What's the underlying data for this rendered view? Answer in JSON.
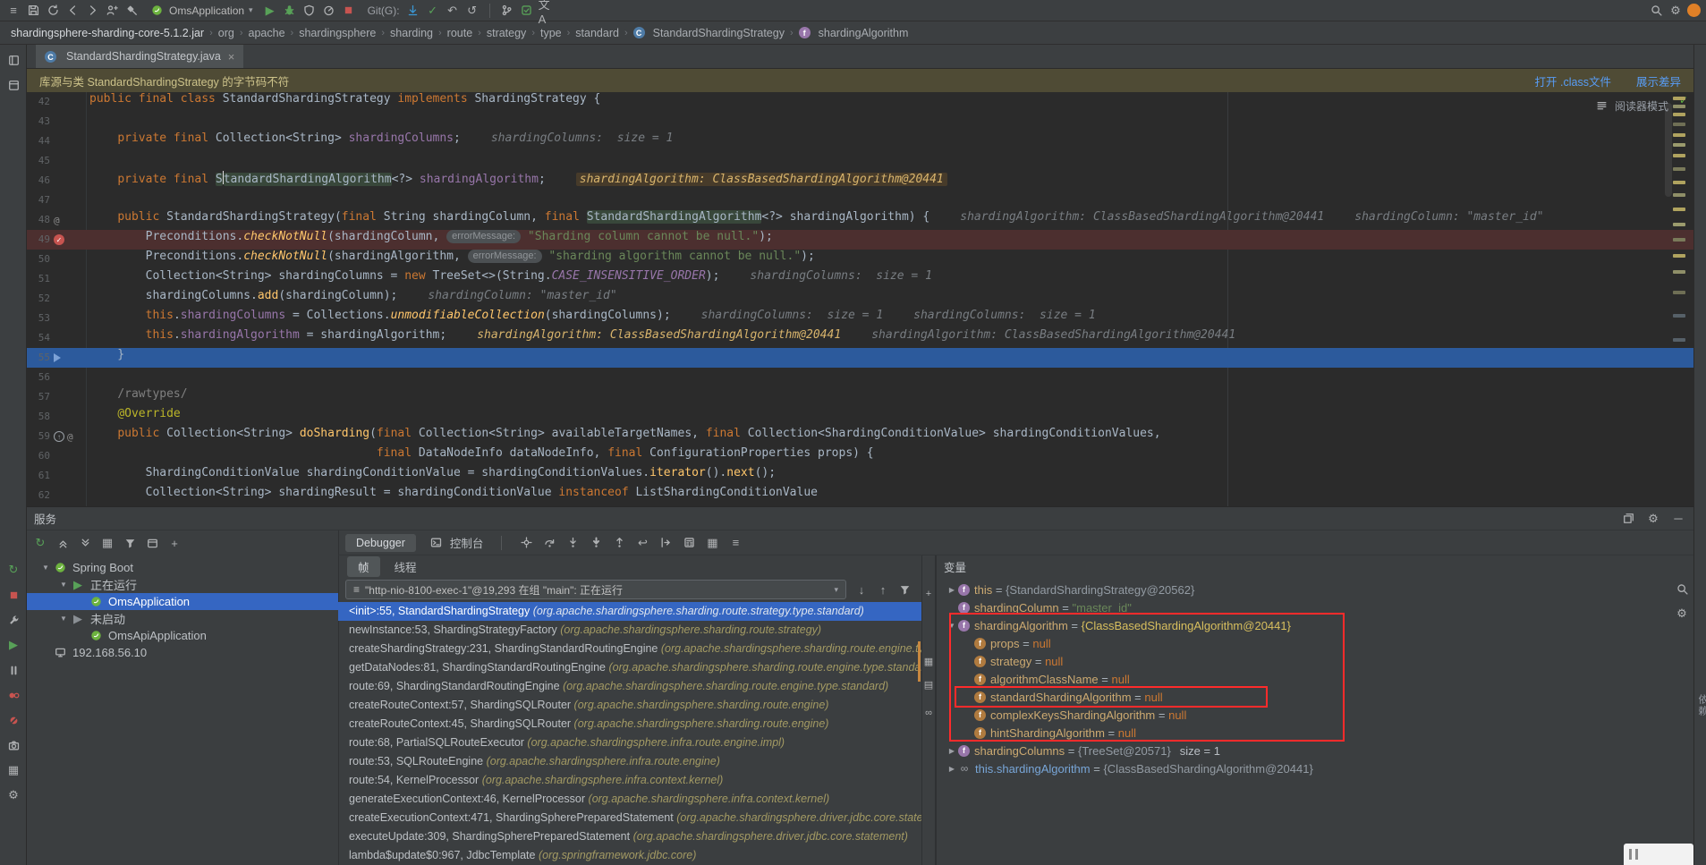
{
  "ide": {
    "left_stripe_top": [
      "project-stripe",
      "commit-stripe"
    ]
  },
  "colors": {
    "selection": "#3566c2",
    "execution_line": "#2c5a9c",
    "breakpoint_line": "#4c2f2f",
    "annotation_box": "#ff2b2b",
    "notification_bg": "#4f4b35",
    "link": "#589df6",
    "run_green": "#58a158",
    "stop_red": "#c75450",
    "spring_green": "#6db33f"
  },
  "toolbar": {
    "left_icons": [
      "main-menu",
      "save",
      "sync",
      "back",
      "forward",
      "project-structure",
      "build-hammer"
    ],
    "run_config": {
      "label": "OmsApplication"
    },
    "run_icons": [
      "run",
      "debug",
      "coverage",
      "profiler",
      "stop"
    ],
    "git": {
      "label": "Git(G):",
      "icons": [
        "update-project",
        "commit-check",
        "rollback",
        "show-history"
      ]
    },
    "vcs_icons": [
      "branch",
      "commit-push",
      "translate"
    ],
    "right_icons": [
      "search",
      "settings"
    ]
  },
  "breadcrumbs": {
    "items": [
      {
        "label": "shardingsphere-sharding-core-5.1.2.jar",
        "bold": true
      },
      {
        "label": "org"
      },
      {
        "label": "apache"
      },
      {
        "label": "shardingsphere"
      },
      {
        "label": "sharding"
      },
      {
        "label": "route"
      },
      {
        "label": "strategy"
      },
      {
        "label": "type"
      },
      {
        "label": "standard"
      },
      {
        "label": "StandardShardingStrategy",
        "icon": "class"
      },
      {
        "label": "shardingAlgorithm",
        "icon": "field"
      }
    ]
  },
  "tabs": [
    {
      "label": "StandardShardingStrategy.java",
      "icon": "class",
      "close": "×"
    }
  ],
  "notification": {
    "message": "库源与类 StandardShardingStrategy 的字节码不符",
    "actions": [
      "打开 .class文件",
      "展示差异"
    ]
  },
  "editor": {
    "reader_mode": "阅读器模式",
    "lines": [
      {
        "n": 42,
        "seg": [
          [
            "public final class ",
            "k"
          ],
          [
            "StandardShardingStrategy ",
            "t"
          ],
          [
            "implements ",
            "k"
          ],
          [
            "ShardingStrategy {",
            "t"
          ]
        ]
      },
      {
        "n": 43,
        "seg": []
      },
      {
        "n": 44,
        "seg": [
          [
            "    ",
            "t"
          ],
          [
            "private final ",
            "k"
          ],
          [
            "Collection<String> ",
            "t"
          ],
          [
            "shardingColumns",
            "f"
          ],
          [
            ";",
            "t"
          ]
        ],
        "hints": [
          [
            "shardingColumns:  size = 1",
            "g"
          ]
        ]
      },
      {
        "n": 45,
        "seg": []
      },
      {
        "n": 46,
        "seg": [
          [
            "    ",
            "t"
          ],
          [
            "private final ",
            "k"
          ],
          [
            "S",
            "hl"
          ],
          [
            "",
            "caret"
          ],
          [
            "tandardShardingAlgorithm",
            "hl"
          ],
          [
            "<?> ",
            "t"
          ],
          [
            "shardingAlgorithm",
            "f"
          ],
          [
            ";",
            "t"
          ]
        ],
        "hints": [
          [
            "shardingAlgorithm: ClassBasedShardingAlgorithm@20441",
            "goldbg"
          ]
        ]
      },
      {
        "n": 47,
        "seg": []
      },
      {
        "n": 48,
        "gutter": "at",
        "seg": [
          [
            "    ",
            "t"
          ],
          [
            "public ",
            "k"
          ],
          [
            "StandardShardingStrategy(",
            "t"
          ],
          [
            "final ",
            "k"
          ],
          [
            "String shardingColumn, ",
            "t"
          ],
          [
            "final ",
            "k"
          ],
          [
            "StandardShardingAlgorithm",
            "hl"
          ],
          [
            "<?> shardingAlgorithm) {",
            "t"
          ]
        ],
        "hints": [
          [
            "shardingAlgorithm: ClassBasedShardingAlgorithm@20441",
            "g"
          ],
          [
            "shardingColumn: \"master_id\"",
            "g"
          ]
        ]
      },
      {
        "n": 49,
        "bg": "bp",
        "gutter": "bp",
        "seg": [
          [
            "        Preconditions.",
            "t"
          ],
          [
            "checkNotNull",
            "sm"
          ],
          [
            "(shardingColumn, ",
            "t"
          ],
          [
            "errorMessage:",
            "chip"
          ],
          [
            " ",
            "t"
          ],
          [
            "\"Sharding column cannot be null.\"",
            "s"
          ],
          [
            ");",
            "t"
          ]
        ]
      },
      {
        "n": 50,
        "seg": [
          [
            "        Preconditions.",
            "t"
          ],
          [
            "checkNotNull",
            "sm"
          ],
          [
            "(shardingAlgorithm, ",
            "t"
          ],
          [
            "errorMessage:",
            "chip"
          ],
          [
            " ",
            "t"
          ],
          [
            "\"sharding algorithm cannot be null.\"",
            "s"
          ],
          [
            ");",
            "t"
          ]
        ]
      },
      {
        "n": 51,
        "seg": [
          [
            "        Collection<String> shardingColumns = ",
            "t"
          ],
          [
            "new ",
            "k"
          ],
          [
            "TreeSet<>(String.",
            "t"
          ],
          [
            "CASE_INSENSITIVE_ORDER",
            "sf"
          ],
          [
            ");",
            "t"
          ]
        ],
        "hints": [
          [
            "shardingColumns:  size = 1",
            "g"
          ]
        ]
      },
      {
        "n": 52,
        "seg": [
          [
            "        shardingColumns.",
            "t"
          ],
          [
            "add",
            "m"
          ],
          [
            "(shardingColumn);",
            "t"
          ]
        ],
        "hints": [
          [
            "shardingColumn: \"master_id\"",
            "g"
          ]
        ]
      },
      {
        "n": 53,
        "seg": [
          [
            "        ",
            "t"
          ],
          [
            "this",
            "k"
          ],
          [
            ".",
            "t"
          ],
          [
            "shardingColumns",
            "f"
          ],
          [
            " = Collections.",
            "t"
          ],
          [
            "unmodifiableCollection",
            "sm"
          ],
          [
            "(shardingColumns);",
            "t"
          ]
        ],
        "hints": [
          [
            "shardingColumns:  size = 1",
            "g"
          ],
          [
            "shardingColumns:  size = 1",
            "g"
          ]
        ]
      },
      {
        "n": 54,
        "seg": [
          [
            "        ",
            "t"
          ],
          [
            "this",
            "k"
          ],
          [
            ".",
            "t"
          ],
          [
            "shardingAlgorithm",
            "f"
          ],
          [
            " = shardingAlgorithm;",
            "t"
          ]
        ],
        "hints": [
          [
            "shardingAlgorithm: ClassBasedShardingAlgorithm@20441",
            "gold"
          ],
          [
            "shardingAlgorithm: ClassBasedShardingAlgorithm@20441",
            "g"
          ]
        ]
      },
      {
        "n": 55,
        "bg": "exec",
        "gutter": "exec",
        "seg": [
          [
            "    }",
            "t"
          ]
        ]
      },
      {
        "n": 56,
        "seg": []
      },
      {
        "n": 57,
        "seg": [
          [
            "    ",
            "t"
          ],
          [
            "/rawtypes/",
            "c"
          ]
        ]
      },
      {
        "n": 58,
        "seg": [
          [
            "    ",
            "t"
          ],
          [
            "@Override",
            "a"
          ]
        ]
      },
      {
        "n": 59,
        "gutter": "override",
        "seg": [
          [
            "    ",
            "t"
          ],
          [
            "public ",
            "k"
          ],
          [
            "Collection<String> ",
            "t"
          ],
          [
            "doSharding",
            "m"
          ],
          [
            "(",
            "t"
          ],
          [
            "final ",
            "k"
          ],
          [
            "Collection<String> availableTargetNames, ",
            "t"
          ],
          [
            "final ",
            "k"
          ],
          [
            "Collection<ShardingConditionValue> shardingConditionValues,",
            "t"
          ]
        ]
      },
      {
        "n": 60,
        "seg": [
          [
            "                                         ",
            "t"
          ],
          [
            "final ",
            "k"
          ],
          [
            "DataNodeInfo dataNodeInfo, ",
            "t"
          ],
          [
            "final ",
            "k"
          ],
          [
            "ConfigurationProperties props) {",
            "t"
          ]
        ]
      },
      {
        "n": 61,
        "seg": [
          [
            "        ShardingConditionValue shardingConditionValue = shardingConditionValues.",
            "t"
          ],
          [
            "iterator",
            "m"
          ],
          [
            "().",
            "t"
          ],
          [
            "next",
            "m"
          ],
          [
            "();",
            "t"
          ]
        ]
      },
      {
        "n": 62,
        "seg": [
          [
            "        Collection<String> shardingResult = shardingConditionValue ",
            "t"
          ],
          [
            "instanceof ",
            "k"
          ],
          [
            "ListShardingConditionValue",
            "t"
          ]
        ]
      }
    ]
  },
  "services": {
    "title": "服务",
    "header_icons": [
      "float",
      "settings",
      "hide"
    ],
    "toolbar_icons": [
      "rerun",
      "collapse-all",
      "expand-all",
      "group-by",
      "filter",
      "frame-view",
      "add"
    ],
    "stripe_icons": [
      "rerun",
      "stop",
      "wrench",
      "resume",
      "pause",
      "view-breakpoints",
      "mute-breakpoints",
      "thread-dump",
      "layout",
      "settings"
    ],
    "tree": [
      {
        "indent": 0,
        "chevron": "down",
        "icon": "spring-boot",
        "label": "Spring Boot"
      },
      {
        "indent": 1,
        "chevron": "down",
        "icon": "running",
        "label": "正在运行"
      },
      {
        "indent": 2,
        "chevron": "none",
        "icon": "spring-boot",
        "label": "OmsApplication",
        "selected": true
      },
      {
        "indent": 1,
        "chevron": "down",
        "icon": "stopped",
        "label": "未启动"
      },
      {
        "indent": 2,
        "chevron": "none",
        "icon": "spring-boot",
        "label": "OmsApiApplication"
      },
      {
        "indent": 0,
        "chevron": "none",
        "icon": "host",
        "label": "192.168.56.10"
      }
    ]
  },
  "debugger": {
    "tabs": [
      {
        "label": "Debugger"
      },
      {
        "label": "控制台",
        "icon": "console"
      }
    ],
    "toolbar_icons": [
      "show-execution-point",
      "step-over",
      "step-into",
      "force-step-into",
      "step-out",
      "drop-frame",
      "run-to-cursor",
      "evaluate",
      "layout",
      "layout-menu"
    ],
    "frames_tab": "帧",
    "threads_tab": "线程",
    "thread_dropdown": "\"http-nio-8100-exec-1\"@19,293 在组 \"main\": 正在运行",
    "frame_nav_icons": [
      "frame-down",
      "frame-up",
      "filter"
    ],
    "side_icons": [
      "add",
      "layout",
      "restore-layout",
      "infinity"
    ],
    "frames": [
      {
        "loc": "<init>:55, StandardShardingStrategy",
        "pkg": "(org.apache.shardingsphere.sharding.route.strategy.type.standard)",
        "selected": true
      },
      {
        "loc": "newInstance:53, ShardingStrategyFactory",
        "pkg": "(org.apache.shardingsphere.sharding.route.strategy)"
      },
      {
        "loc": "createShardingStrategy:231, ShardingStandardRoutingEngine",
        "pkg": "(org.apache.shardingsphere.sharding.route.engine.type.standard)"
      },
      {
        "loc": "getDataNodes:81, ShardingStandardRoutingEngine",
        "pkg": "(org.apache.shardingsphere.sharding.route.engine.type.standard)"
      },
      {
        "loc": "route:69, ShardingStandardRoutingEngine",
        "pkg": "(org.apache.shardingsphere.sharding.route.engine.type.standard)"
      },
      {
        "loc": "createRouteContext:57, ShardingSQLRouter",
        "pkg": "(org.apache.shardingsphere.sharding.route.engine)"
      },
      {
        "loc": "createRouteContext:45, ShardingSQLRouter",
        "pkg": "(org.apache.shardingsphere.sharding.route.engine)"
      },
      {
        "loc": "route:68, PartialSQLRouteExecutor",
        "pkg": "(org.apache.shardingsphere.infra.route.engine.impl)"
      },
      {
        "loc": "route:53, SQLRouteEngine",
        "pkg": "(org.apache.shardingsphere.infra.route.engine)"
      },
      {
        "loc": "route:54, KernelProcessor",
        "pkg": "(org.apache.shardingsphere.infra.context.kernel)"
      },
      {
        "loc": "generateExecutionContext:46, KernelProcessor",
        "pkg": "(org.apache.shardingsphere.infra.context.kernel)"
      },
      {
        "loc": "createExecutionContext:471, ShardingSpherePreparedStatement",
        "pkg": "(org.apache.shardingsphere.driver.jdbc.core.statement)"
      },
      {
        "loc": "executeUpdate:309, ShardingSpherePreparedStatement",
        "pkg": "(org.apache.shardingsphere.driver.jdbc.core.statement)"
      },
      {
        "loc": "lambda$update$0:967, JdbcTemplate",
        "pkg": "(org.springframework.jdbc.core)"
      }
    ]
  },
  "variables": {
    "title": "变量",
    "rows": [
      {
        "indent": 0,
        "chevron": "right",
        "icon": "field",
        "name": "this",
        "value": "{StandardShardingStrategy@20562}",
        "vt": "ref"
      },
      {
        "indent": 0,
        "chevron": "none",
        "icon": "field",
        "name": "shardingColumn",
        "value": "\"master_id\"",
        "vt": "str"
      },
      {
        "indent": 0,
        "chevron": "down",
        "icon": "field",
        "name": "shardingAlgorithm",
        "value": "{ClassBasedShardingAlgorithm@20441}",
        "vt": "gold"
      },
      {
        "indent": 1,
        "chevron": "none",
        "icon": "field-amber",
        "name": "props",
        "value": "null",
        "vt": "null"
      },
      {
        "indent": 1,
        "chevron": "none",
        "icon": "field-amber",
        "name": "strategy",
        "value": "null",
        "vt": "null"
      },
      {
        "indent": 1,
        "chevron": "none",
        "icon": "field-amber",
        "name": "algorithmClassName",
        "value": "null",
        "vt": "null"
      },
      {
        "indent": 1,
        "chevron": "none",
        "icon": "field-amber",
        "name": "standardShardingAlgorithm",
        "value": "null",
        "vt": "null"
      },
      {
        "indent": 1,
        "chevron": "none",
        "icon": "field-amber",
        "name": "complexKeysShardingAlgorithm",
        "value": "null",
        "vt": "null"
      },
      {
        "indent": 1,
        "chevron": "none",
        "icon": "field-amber",
        "name": "hintShardingAlgorithm",
        "value": "null",
        "vt": "null"
      },
      {
        "indent": 0,
        "chevron": "right",
        "icon": "field",
        "name": "shardingColumns",
        "value": "{TreeSet@20571}",
        "vt": "ref",
        "extra": "size = 1"
      },
      {
        "indent": 0,
        "chevron": "right",
        "icon": "watch",
        "name": "this.shardingAlgorithm",
        "value": "{ClassBasedShardingAlgorithm@20441}",
        "vt": "ref",
        "watch": true
      }
    ],
    "side_icons": [
      "search",
      "settings"
    ]
  },
  "right_stripe_label": "依赖"
}
